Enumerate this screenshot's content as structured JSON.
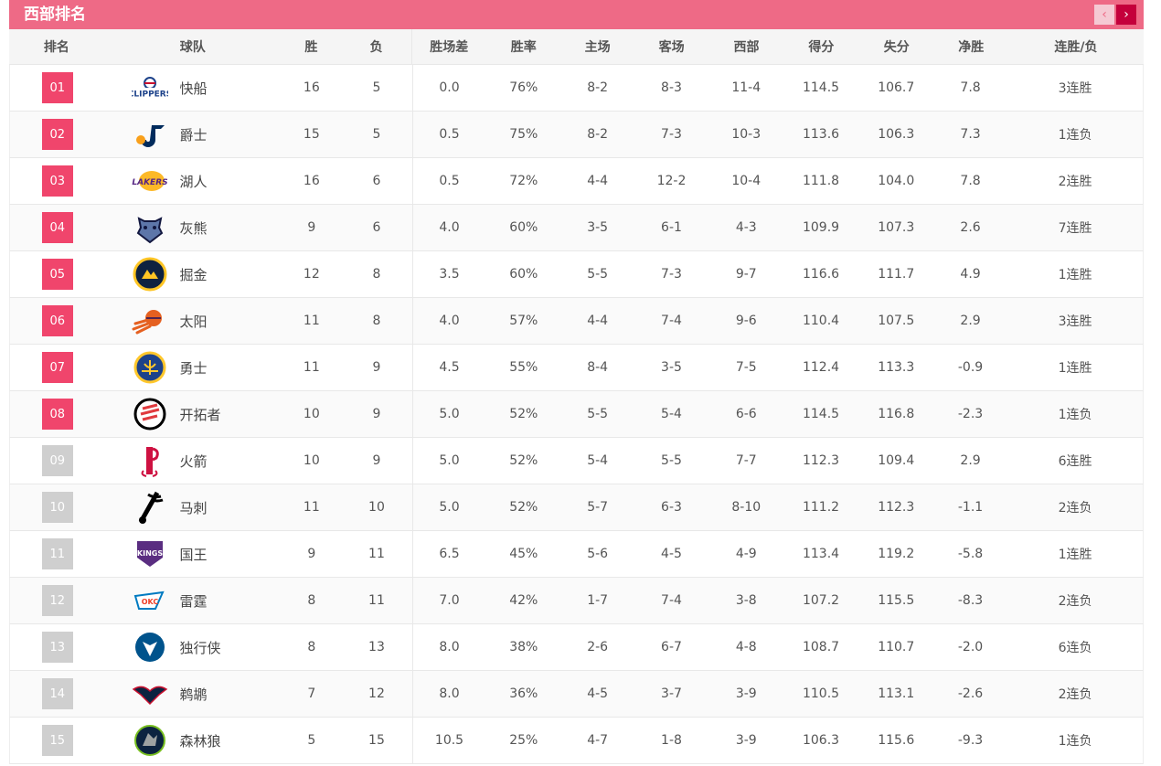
{
  "header": {
    "title": "西部排名",
    "prev": "‹",
    "next": "›"
  },
  "columns": [
    "排名",
    "球队",
    "胜",
    "负",
    "胜场差",
    "胜率",
    "主场",
    "客场",
    "西部",
    "得分",
    "失分",
    "净胜",
    "连胜/负"
  ],
  "rows": [
    {
      "rank": "01",
      "team": "快船",
      "logo": "clippers-logo",
      "w": "16",
      "l": "5",
      "gb": "0.0",
      "pct": "76%",
      "home": "8-2",
      "away": "8-3",
      "west": "11-4",
      "pts": "114.5",
      "opp": "106.7",
      "net": "7.8",
      "streak": "3连胜"
    },
    {
      "rank": "02",
      "team": "爵士",
      "logo": "jazz-logo",
      "w": "15",
      "l": "5",
      "gb": "0.5",
      "pct": "75%",
      "home": "8-2",
      "away": "7-3",
      "west": "10-3",
      "pts": "113.6",
      "opp": "106.3",
      "net": "7.3",
      "streak": "1连负"
    },
    {
      "rank": "03",
      "team": "湖人",
      "logo": "lakers-logo",
      "w": "16",
      "l": "6",
      "gb": "0.5",
      "pct": "72%",
      "home": "4-4",
      "away": "12-2",
      "west": "10-4",
      "pts": "111.8",
      "opp": "104.0",
      "net": "7.8",
      "streak": "2连胜"
    },
    {
      "rank": "04",
      "team": "灰熊",
      "logo": "grizzlies-logo",
      "w": "9",
      "l": "6",
      "gb": "4.0",
      "pct": "60%",
      "home": "3-5",
      "away": "6-1",
      "west": "4-3",
      "pts": "109.9",
      "opp": "107.3",
      "net": "2.6",
      "streak": "7连胜"
    },
    {
      "rank": "05",
      "team": "掘金",
      "logo": "nuggets-logo",
      "w": "12",
      "l": "8",
      "gb": "3.5",
      "pct": "60%",
      "home": "5-5",
      "away": "7-3",
      "west": "9-7",
      "pts": "116.6",
      "opp": "111.7",
      "net": "4.9",
      "streak": "1连胜"
    },
    {
      "rank": "06",
      "team": "太阳",
      "logo": "suns-logo",
      "w": "11",
      "l": "8",
      "gb": "4.0",
      "pct": "57%",
      "home": "4-4",
      "away": "7-4",
      "west": "9-6",
      "pts": "110.4",
      "opp": "107.5",
      "net": "2.9",
      "streak": "3连胜"
    },
    {
      "rank": "07",
      "team": "勇士",
      "logo": "warriors-logo",
      "w": "11",
      "l": "9",
      "gb": "4.5",
      "pct": "55%",
      "home": "8-4",
      "away": "3-5",
      "west": "7-5",
      "pts": "112.4",
      "opp": "113.3",
      "net": "-0.9",
      "streak": "1连胜"
    },
    {
      "rank": "08",
      "team": "开拓者",
      "logo": "blazers-logo",
      "w": "10",
      "l": "9",
      "gb": "5.0",
      "pct": "52%",
      "home": "5-5",
      "away": "5-4",
      "west": "6-6",
      "pts": "114.5",
      "opp": "116.8",
      "net": "-2.3",
      "streak": "1连负"
    },
    {
      "rank": "09",
      "team": "火箭",
      "logo": "rockets-logo",
      "w": "10",
      "l": "9",
      "gb": "5.0",
      "pct": "52%",
      "home": "5-4",
      "away": "5-5",
      "west": "7-7",
      "pts": "112.3",
      "opp": "109.4",
      "net": "2.9",
      "streak": "6连胜"
    },
    {
      "rank": "10",
      "team": "马刺",
      "logo": "spurs-logo",
      "w": "11",
      "l": "10",
      "gb": "5.0",
      "pct": "52%",
      "home": "5-7",
      "away": "6-3",
      "west": "8-10",
      "pts": "111.2",
      "opp": "112.3",
      "net": "-1.1",
      "streak": "2连负"
    },
    {
      "rank": "11",
      "team": "国王",
      "logo": "kings-logo",
      "w": "9",
      "l": "11",
      "gb": "6.5",
      "pct": "45%",
      "home": "5-6",
      "away": "4-5",
      "west": "4-9",
      "pts": "113.4",
      "opp": "119.2",
      "net": "-5.8",
      "streak": "1连胜"
    },
    {
      "rank": "12",
      "team": "雷霆",
      "logo": "thunder-logo",
      "w": "8",
      "l": "11",
      "gb": "7.0",
      "pct": "42%",
      "home": "1-7",
      "away": "7-4",
      "west": "3-8",
      "pts": "107.2",
      "opp": "115.5",
      "net": "-8.3",
      "streak": "2连负"
    },
    {
      "rank": "13",
      "team": "独行侠",
      "logo": "mavericks-logo",
      "w": "8",
      "l": "13",
      "gb": "8.0",
      "pct": "38%",
      "home": "2-6",
      "away": "6-7",
      "west": "4-8",
      "pts": "108.7",
      "opp": "110.7",
      "net": "-2.0",
      "streak": "6连负"
    },
    {
      "rank": "14",
      "team": "鹈鹕",
      "logo": "pelicans-logo",
      "w": "7",
      "l": "12",
      "gb": "8.0",
      "pct": "36%",
      "home": "4-5",
      "away": "3-7",
      "west": "3-9",
      "pts": "110.5",
      "opp": "113.1",
      "net": "-2.6",
      "streak": "2连负"
    },
    {
      "rank": "15",
      "team": "森林狼",
      "logo": "timberwolves-logo",
      "w": "5",
      "l": "15",
      "gb": "10.5",
      "pct": "25%",
      "home": "4-7",
      "away": "1-8",
      "west": "3-9",
      "pts": "106.3",
      "opp": "115.6",
      "net": "-9.3",
      "streak": "1连负"
    }
  ],
  "logo_text": {
    "clippers": "CLIPPERS",
    "lakers": "LAKERS",
    "kings": "KINGS",
    "thunder": "OKC"
  },
  "colors": {
    "header": "#ee6a86",
    "rank_playoff": "#f0456c",
    "rank_other": "#cfcfcf",
    "nav_active": "#c4003b"
  }
}
